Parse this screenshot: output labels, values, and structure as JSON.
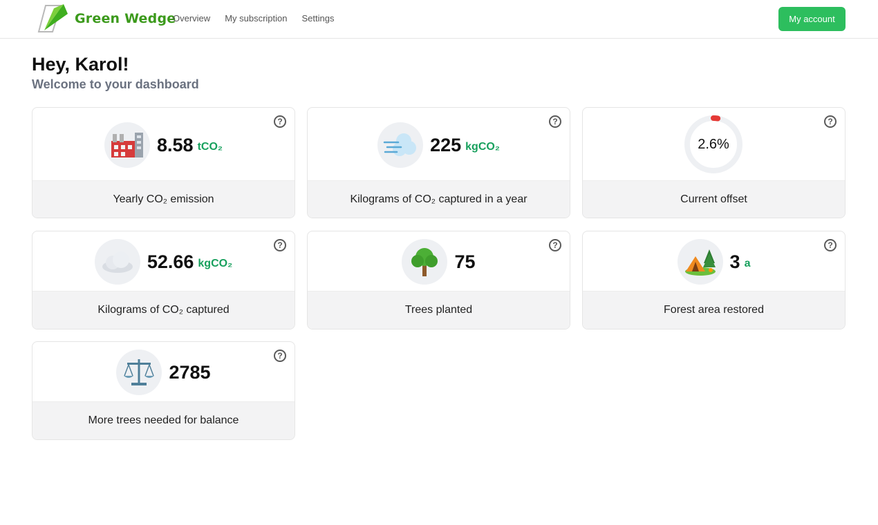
{
  "header": {
    "brand": "Green Wedge",
    "nav": [
      "Overview",
      "My subscription",
      "Settings"
    ],
    "account_button": "My account",
    "brand_color": "#3c9a1c",
    "accent_color": "#2dbe5e"
  },
  "greeting": {
    "title": "Hey, Karol!",
    "subtitle": "Welcome to your dashboard"
  },
  "help_glyph": "?",
  "cards": {
    "yearly_emission": {
      "value": "8.58",
      "unit": "tCO₂",
      "label": "Yearly CO₂ emission",
      "icon": "factory-icon"
    },
    "captured_year": {
      "value": "225",
      "unit": "kgCO₂",
      "label": "Kilograms of CO₂ captured in a year",
      "icon": "wind-cloud-icon"
    },
    "current_offset": {
      "value": "2.6%",
      "label": "Current offset",
      "progress_percent": 2.6,
      "ring_color": "#e53935"
    },
    "captured_total": {
      "value": "52.66",
      "unit": "kgCO₂",
      "label": "Kilograms of CO₂ captured",
      "icon": "cloud-icon"
    },
    "trees_planted": {
      "value": "75",
      "label": "Trees planted",
      "icon": "tree-icon"
    },
    "forest_area": {
      "value": "3",
      "unit": "a",
      "label": "Forest area restored",
      "icon": "camping-icon"
    },
    "trees_needed": {
      "value": "2785",
      "label": "More trees needed for balance",
      "icon": "balance-scale-icon"
    }
  }
}
